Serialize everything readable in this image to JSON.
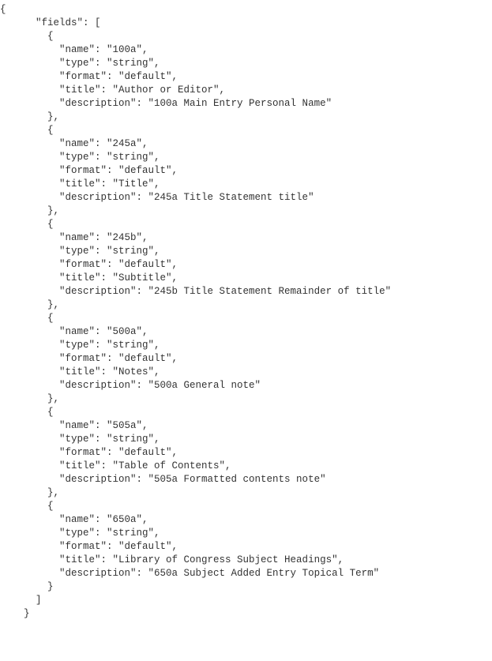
{
  "code_lines": [
    "{",
    "      \"fields\": [",
    "        {",
    "          \"name\": \"100a\",",
    "          \"type\": \"string\",",
    "          \"format\": \"default\",",
    "          \"title\": \"Author or Editor\",",
    "          \"description\": \"100a Main Entry Personal Name\"",
    "        },",
    "        {",
    "          \"name\": \"245a\",",
    "          \"type\": \"string\",",
    "          \"format\": \"default\",",
    "          \"title\": \"Title\",",
    "          \"description\": \"245a Title Statement title\"",
    "        },",
    "        {",
    "          \"name\": \"245b\",",
    "          \"type\": \"string\",",
    "          \"format\": \"default\",",
    "          \"title\": \"Subtitle\",",
    "          \"description\": \"245b Title Statement Remainder of title\"",
    "        },",
    "        {",
    "          \"name\": \"500a\",",
    "          \"type\": \"string\",",
    "          \"format\": \"default\",",
    "          \"title\": \"Notes\",",
    "          \"description\": \"500a General note\"",
    "        },",
    "        {",
    "          \"name\": \"505a\",",
    "          \"type\": \"string\",",
    "          \"format\": \"default\",",
    "          \"title\": \"Table of Contents\",",
    "          \"description\": \"505a Formatted contents note\"",
    "        },",
    "        {",
    "          \"name\": \"650a\",",
    "          \"type\": \"string\",",
    "          \"format\": \"default\",",
    "          \"title\": \"Library of Congress Subject Headings\",",
    "          \"description\": \"650a Subject Added Entry Topical Term\"",
    "        }",
    "      ]",
    "    }"
  ]
}
